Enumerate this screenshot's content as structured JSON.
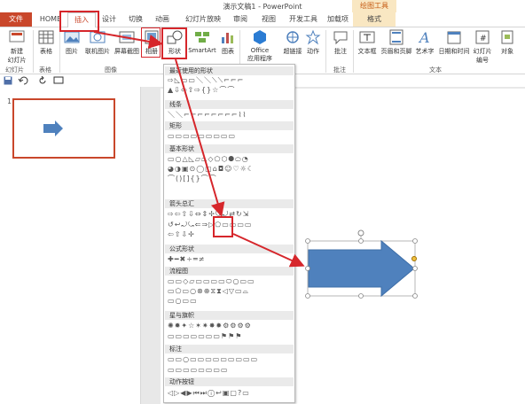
{
  "window": {
    "title": "演示文稿1 - PowerPoint",
    "context_group": "绘图工具"
  },
  "tabs": [
    {
      "label": "文件"
    },
    {
      "label": "HOME"
    },
    {
      "label": "插入"
    },
    {
      "label": "设计"
    },
    {
      "label": "切换"
    },
    {
      "label": "动画"
    },
    {
      "label": "幻灯片放映"
    },
    {
      "label": "审阅"
    },
    {
      "label": "视图"
    },
    {
      "label": "开发工具"
    },
    {
      "label": "加载项"
    },
    {
      "label": "格式"
    }
  ],
  "ribbon": {
    "new_slide": "新建\n幻灯片",
    "table": "表格",
    "picture": "图片",
    "online_picture": "联机图片",
    "screenshot": "屏幕截图",
    "album": "相册",
    "shapes": "形状",
    "smartart": "SmartArt",
    "chart": "图表",
    "office_apps": "Office\n应用程序",
    "hyperlink": "超链接",
    "action": "动作",
    "comment": "批注",
    "textbox": "文本框",
    "header_footer": "页眉和页脚",
    "wordart": "艺术字",
    "datetime": "日期和时间",
    "slide_number": "幻灯片\n编号",
    "object": "对象"
  },
  "groups": {
    "slides": "幻灯片",
    "tables": "表格",
    "images": "图像",
    "comments": "批注",
    "text": "文本"
  },
  "slide_panel": {
    "slide_number": "1"
  },
  "shapes_menu": {
    "sections": [
      {
        "title": "最近使用的形状",
        "rows": [
          "⇨◺▭▭＼＼⟍⟍⌐⌐⌐",
          "▲⇩⇦⇧⇨{}☆⌒⌒"
        ]
      },
      {
        "title": "线条",
        "rows": [
          "＼＼⌐⌐⌐⌐⌐⌐⌐⌐⌇⌇"
        ]
      },
      {
        "title": "矩形",
        "rows": [
          "▭▭▭▭▭▭▭▭▭"
        ]
      },
      {
        "title": "基本形状",
        "rows": [
          "▭○△◺▱⏢◇⬠⬡⯃⬭◔",
          "◕◑▣⊙◯▢⌂◘☺♡☼☾",
          "⌒()[]{}⌒⌒"
        ]
      },
      {
        "title": "箭头总汇",
        "rows": [
          "⇨⇦⇧⇩⇔⇕✢⤿⤾⇄↻⇲",
          "↺↩⤾⤿⇐⇒▷⬠▭▭▭▭",
          "⇦⇧⇩✢"
        ]
      },
      {
        "title": "公式形状",
        "rows": [
          "✚━✖÷═≠"
        ]
      },
      {
        "title": "流程图",
        "rows": [
          "▭▭◇▱▭▭▭▭⬭○▭▭",
          "▭⬠▭○⊗⊕⧖⧗◁▽▭⌓",
          "▭○▭▭"
        ]
      },
      {
        "title": "星与旗帜",
        "rows": [
          "✺✹✦☆✶✷✸✹⚙⚙⚙⚙",
          "▭▭▭▭▭▭▭⚑⚑⚑"
        ]
      },
      {
        "title": "标注",
        "rows": [
          "▭▭○▭▭▭▭▭▭▭▭▭",
          "▭▭▭▭▭▭▭▭"
        ]
      },
      {
        "title": "动作按钮",
        "rows": [
          "◁▷◀▶⏮⏭ⓘ↩▣▢?▭"
        ]
      }
    ]
  },
  "colors": {
    "accent": "#c9472b",
    "arrow_fill": "#4f81bd",
    "highlight_red": "#d6262b"
  }
}
